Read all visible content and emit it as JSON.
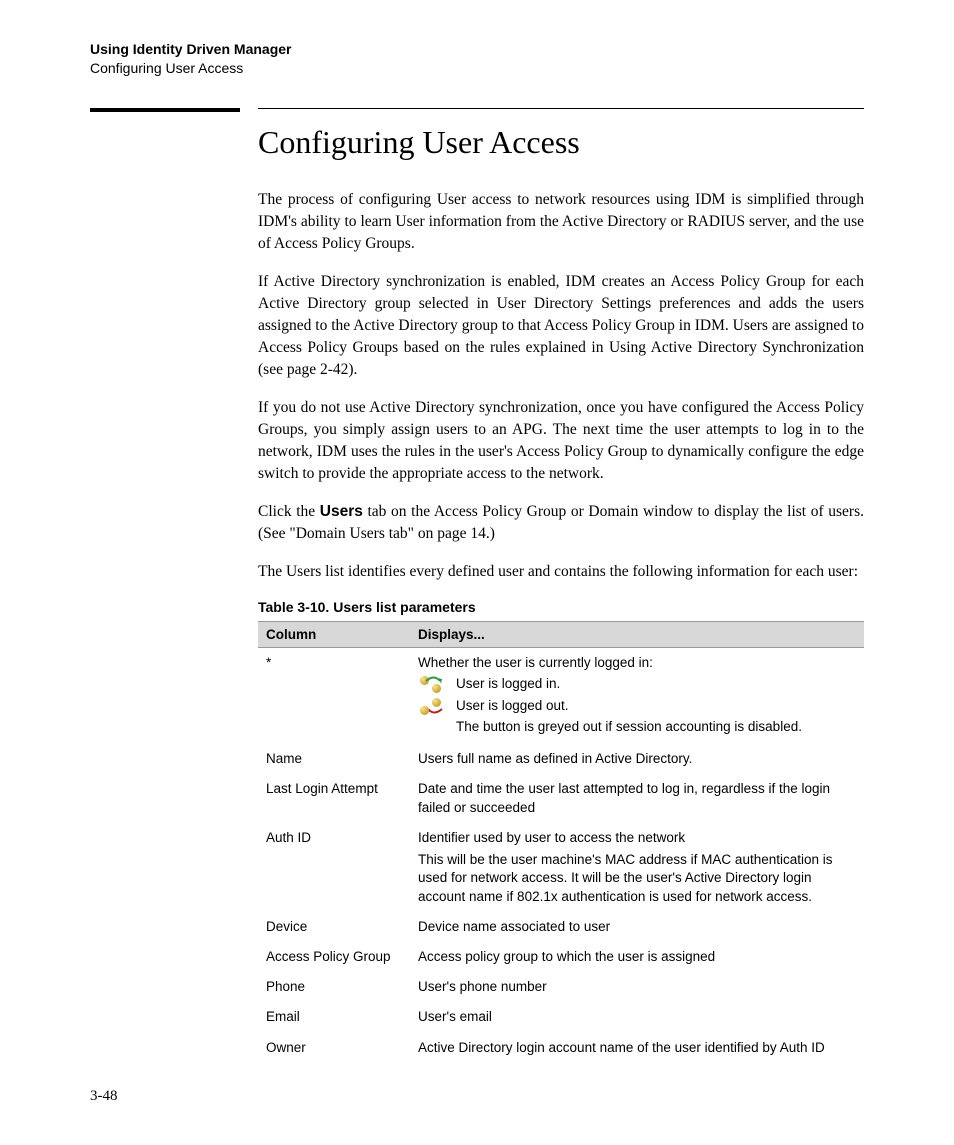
{
  "header": {
    "title": "Using Identity Driven Manager",
    "subtitle": "Configuring User Access"
  },
  "section_heading": "Configuring User Access",
  "paragraphs": {
    "p1": "The process of configuring User access to network resources using IDM is simplified through IDM's ability to learn User information from the Active Directory or RADIUS server, and the use of Access Policy Groups.",
    "p2": "If Active Directory synchronization is enabled, IDM creates an Access Policy Group for each Active Directory group selected in User Directory Settings preferences and adds the users assigned to the Active Directory group to that Access Policy Group in IDM. Users are assigned to Access Policy Groups based on the rules explained in Using Active Directory Synchronization (see page 2-42).",
    "p3": "If you do not use Active Directory synchronization, once you have configured the Access Policy Groups, you simply assign users to an APG. The next time the user attempts to log in to the network, IDM uses the rules in the user's Access Policy Group to dynamically configure the edge switch to provide the appropriate access to the network.",
    "p4_pre": "Click the ",
    "p4_bold": "Users",
    "p4_post": " tab on the Access Policy Group or Domain window to display the list of users. (See \"Domain Users tab\" on page 14.)",
    "p5": "The Users list identifies every defined user and contains the following information for each user:"
  },
  "table": {
    "caption": "Table 3-10.   Users list parameters",
    "headers": {
      "col": "Column",
      "disp": "Displays..."
    },
    "rows": [
      {
        "col": "*",
        "disp_intro": "Whether the user is currently logged in:",
        "icon_lines": [
          {
            "icon": "login",
            "text": "User is logged in."
          },
          {
            "icon": "logout",
            "text": "User is logged out."
          }
        ],
        "disp_tail": "The button is greyed out if session accounting is disabled."
      },
      {
        "col": "Name",
        "disp": "Users full name as defined in Active Directory."
      },
      {
        "col": "Last Login Attempt",
        "disp": "Date and time the user last attempted to log in, regardless if the login failed or succeeded"
      },
      {
        "col": "Auth ID",
        "disp": "Identifier used by user to access the network",
        "disp2": "This will be the user machine's MAC address if MAC authentication is used for network access. It will be the user's Active Directory login account name if 802.1x authentication is used for network access."
      },
      {
        "col": "Device",
        "disp": "Device name associated to user"
      },
      {
        "col": "Access Policy Group",
        "disp": "Access policy group to which the user is assigned"
      },
      {
        "col": "Phone",
        "disp": "User's phone number"
      },
      {
        "col": "Email",
        "disp": "User's email"
      },
      {
        "col": "Owner",
        "disp": "Active Directory login account name of the user identified by Auth ID"
      }
    ]
  },
  "page_number": "3-48"
}
